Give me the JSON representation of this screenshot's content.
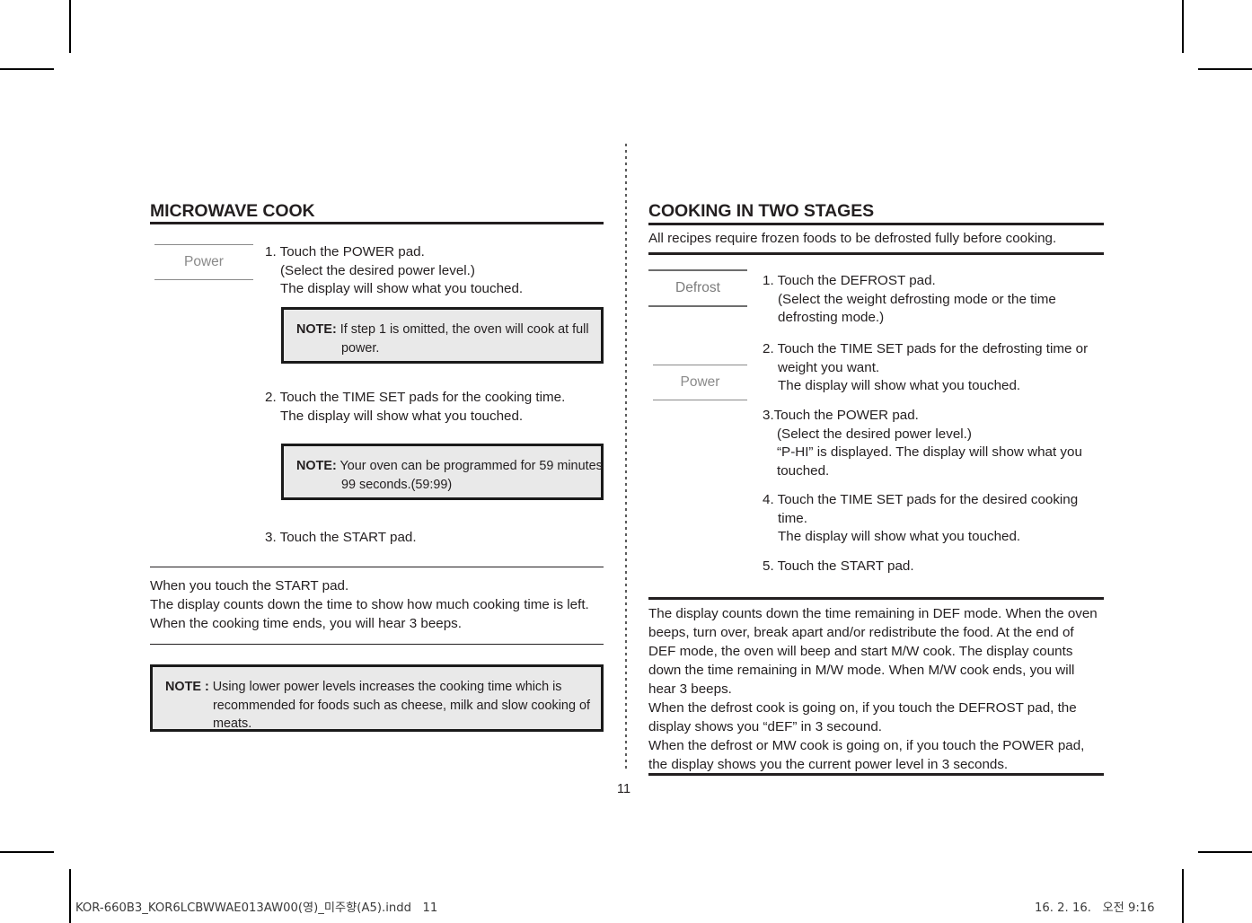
{
  "page": {
    "number": "11"
  },
  "left_column": {
    "title": "MICROWAVE COOK",
    "pad": {
      "label": "Power"
    },
    "step1": {
      "line1": "1. Touch the POWER pad.",
      "line2": "(Select the desired power level.)",
      "line3": "The display will show what you touched."
    },
    "note1": {
      "label": "NOTE:",
      "line1": " If step 1 is omitted, the oven will cook at full",
      "line2": "power."
    },
    "step2": {
      "line1": "2. Touch the TIME SET pads for the cooking time.",
      "line2": "The display will show what you touched."
    },
    "note2": {
      "label": "NOTE:",
      "line1": " Your oven can be programmed for 59 minutes",
      "line2": "99 seconds.(59:99)"
    },
    "step3": {
      "line1": "3. Touch the START pad."
    },
    "summary": {
      "line1": "When you touch the START pad.",
      "line2": "The display counts down the time to show how much cooking time is left.",
      "line3": "When the cooking time ends, you will hear 3 beeps."
    },
    "note3": {
      "label": "NOTE :",
      "line1": " Using lower power levels increases the cooking time which is",
      "line2": "recommended for foods such as cheese, milk and slow cooking of",
      "line3": "meats."
    }
  },
  "right_column": {
    "title": "COOKING IN TWO STAGES",
    "intro": "All recipes require frozen foods to be defrosted fully before cooking.",
    "pad_defrost": {
      "label": "Defrost"
    },
    "pad_power": {
      "label": "Power"
    },
    "step1": {
      "line1": "1. Touch the DEFROST pad.",
      "line2": "(Select the weight defrosting mode or the time",
      "line3": "defrosting mode.)"
    },
    "step2": {
      "line1": "2. Touch the TIME SET pads for the defrosting time or",
      "line2": "weight you want.",
      "line3": "The display will show what you touched."
    },
    "step3": {
      "line1": "3.Touch the POWER pad.",
      "line2": "(Select the desired power level.)",
      "line3": "“P-HI” is displayed. The display will show what you",
      "line4": "touched."
    },
    "step4": {
      "line1": "4. Touch the TIME SET pads for the desired cooking",
      "line2": "time.",
      "line3": "The display will show what you touched."
    },
    "step5": {
      "line1": "5. Touch the START pad."
    },
    "summary": {
      "line1": "The display counts down the time remaining in DEF mode. When the oven",
      "line2": "beeps, turn over, break apart and/or redistribute the food. At the end of",
      "line3": "DEF mode, the oven will beep and start M/W cook. The display counts",
      "line4": "down the time remaining in M/W mode. When M/W cook ends, you will",
      "line5": "hear 3 beeps.",
      "line6": "When the defrost cook is going on, if you touch the DEFROST pad, the",
      "line7": "display shows you “dEF” in 3 secound.",
      "line8": "When the defrost or MW cook is going on, if you touch the POWER pad,",
      "line9": "the display shows you the current power level in 3 seconds."
    }
  },
  "print_footer": {
    "file_name": "KOR-660B3_KOR6LCBWWAE013AW00(영)_미주향(A5).indd   11",
    "date_time": "16. 2. 16.   오전 9:16"
  }
}
